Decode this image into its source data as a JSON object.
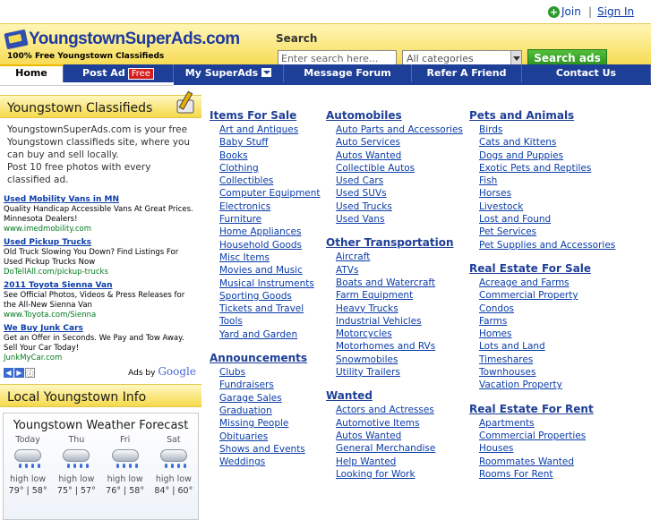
{
  "top": {
    "join": "Join",
    "separator": "|",
    "signin": "Sign In"
  },
  "header": {
    "logo_text": "YoungstownSuperAds.com",
    "tagline": "100% Free Youngstown Classifieds",
    "search_label": "Search",
    "search_placeholder": "Enter search here...",
    "category_value": "All categories",
    "search_button": "Search ads"
  },
  "nav": {
    "home": "Home",
    "post_ad": "Post Ad",
    "free_badge": "Free",
    "my_superads": "My SuperAds",
    "forum": "Message Forum",
    "refer": "Refer A Friend",
    "contact": "Contact Us"
  },
  "left": {
    "classifieds_title": "Youngstown Classifieds",
    "intro": "YoungstownSuperAds.com is your free Youngstown classifieds site, where you can buy and sell locally.",
    "intro2": "Post 10 free photos with every classified ad.",
    "ads": [
      {
        "title": "Used Mobility Vans in MN",
        "body": "Quality Handicap Accessible Vans At Great Prices. Minnesota Dealers!",
        "url": "www.imedmobility.com"
      },
      {
        "title": "Used Pickup Trucks",
        "body": "Old Truck Slowing You Down? Find Listings For Used Pickup Trucks Now",
        "url": "DoTellAll.com/pickup-trucks"
      },
      {
        "title": "2011 Toyota Sienna Van",
        "body": "See Official Photos, Videos & Press Releases for the All-New Sienna Van",
        "url": "www.Toyota.com/Sienna"
      },
      {
        "title": "We Buy Junk Cars",
        "body": "Get an Offer in Seconds. We Pay and Tow Away. Sell Your Car Today!",
        "url": "JunkMyCar.com"
      }
    ],
    "ads_by": "Ads by",
    "google": "Google",
    "local_title": "Local Youngstown Info",
    "weather": {
      "title": "Youngstown Weather Forecast",
      "days": [
        {
          "name": "Today",
          "hilo": "high low",
          "temps": "79° | 58°"
        },
        {
          "name": "Thu",
          "hilo": "high low",
          "temps": "75° | 57°"
        },
        {
          "name": "Fri",
          "hilo": "high low",
          "temps": "76° | 58°"
        },
        {
          "name": "Sat",
          "hilo": "high low",
          "temps": "84° | 60°"
        }
      ]
    }
  },
  "categories": {
    "col1": [
      {
        "head": "Items For Sale",
        "items": [
          "Art and Antiques",
          "Baby Stuff",
          "Books",
          "Clothing",
          "Collectibles",
          "Computer Equipment",
          "Electronics",
          "Furniture",
          "Home Appliances",
          "Household Goods",
          "Misc Items",
          "Movies and Music",
          "Musical Instruments",
          "Sporting Goods",
          "Tickets and Travel",
          "Tools",
          "Yard and Garden"
        ]
      },
      {
        "head": "Announcements",
        "items": [
          "Clubs",
          "Fundraisers",
          "Garage Sales",
          "Graduation",
          "Missing People",
          "Obituaries",
          "Shows and Events",
          "Weddings"
        ]
      }
    ],
    "col2": [
      {
        "head": "Automobiles",
        "items": [
          "Auto Parts and Accessories",
          "Auto Services",
          "Autos Wanted",
          "Collectible Autos",
          "Used Cars",
          "Used SUVs",
          "Used Trucks",
          "Used Vans"
        ]
      },
      {
        "head": "Other Transportation",
        "items": [
          "Aircraft",
          "ATVs",
          "Boats and Watercraft",
          "Farm Equipment",
          "Heavy Trucks",
          "Industrial Vehicles",
          "Motorcycles",
          "Motorhomes and RVs",
          "Snowmobiles",
          "Utility Trailers"
        ]
      },
      {
        "head": "Wanted",
        "items": [
          "Actors and Actresses",
          "Automotive Items",
          "Autos Wanted",
          "General Merchandise",
          "Help Wanted",
          "Looking for Work"
        ]
      }
    ],
    "col3": [
      {
        "head": "Pets and Animals",
        "items": [
          "Birds",
          "Cats and Kittens",
          "Dogs and Puppies",
          "Exotic Pets and Reptiles",
          "Fish",
          "Horses",
          "Livestock",
          "Lost and Found",
          "Pet Services",
          "Pet Supplies and Accessories"
        ]
      },
      {
        "head": "Real Estate For Sale",
        "items": [
          "Acreage and Farms",
          "Commercial Property",
          "Condos",
          "Farms",
          "Homes",
          "Lots and Land",
          "Timeshares",
          "Townhouses",
          "Vacation Property"
        ]
      },
      {
        "head": "Real Estate For Rent",
        "items": [
          "Apartments",
          "Commercial Properties",
          "Houses",
          "Roommates Wanted",
          "Rooms For Rent"
        ]
      }
    ]
  },
  "colors": {
    "nav_blue": "#1e3f97",
    "header_yellow": "#f7dc55",
    "link_blue": "#0a3ca8",
    "search_green": "#3aa52a"
  }
}
